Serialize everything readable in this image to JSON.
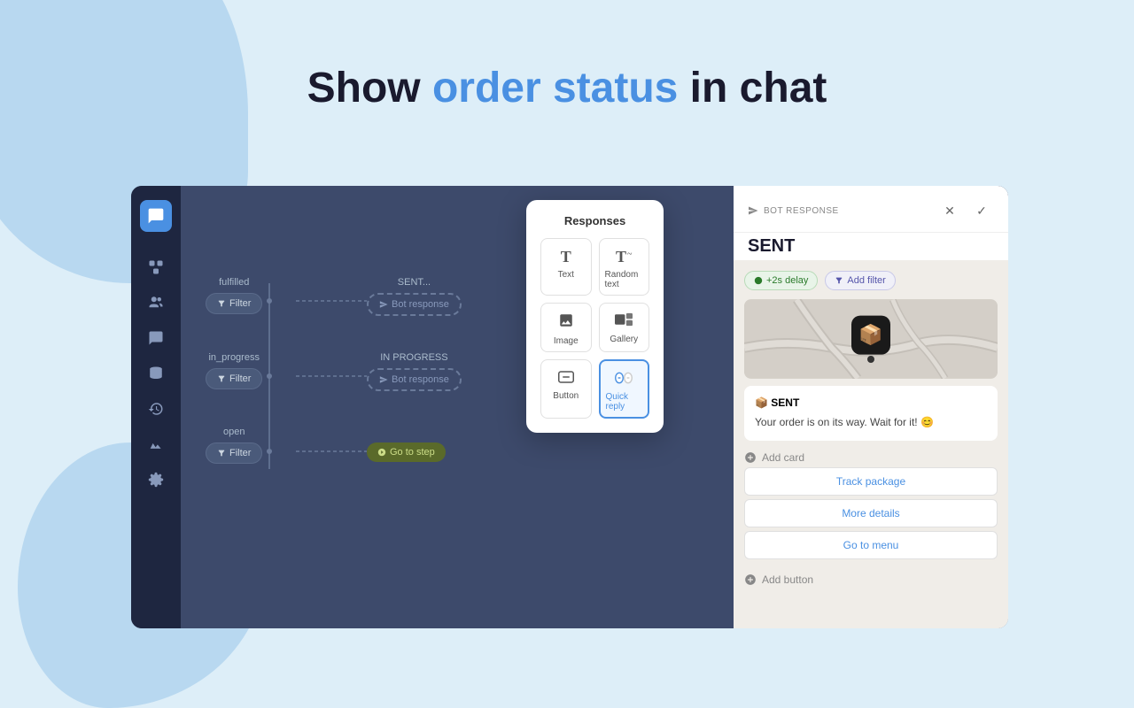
{
  "heading": {
    "prefix": "Show ",
    "highlight1": "order status",
    "middle": " in ",
    "rest": "chat"
  },
  "sidebar": {
    "logo_icon": "💬",
    "items": [
      {
        "icon": "⊞",
        "label": "flow-icon"
      },
      {
        "icon": "👥",
        "label": "contacts-icon"
      },
      {
        "icon": "💬",
        "label": "chat-icon"
      },
      {
        "icon": "🗄",
        "label": "data-icon"
      },
      {
        "icon": "🕐",
        "label": "history-icon"
      },
      {
        "icon": "📈",
        "label": "analytics-icon"
      },
      {
        "icon": "⚙",
        "label": "settings-icon"
      }
    ]
  },
  "flow": {
    "nodes": [
      {
        "label": "fulfilled",
        "filter_text": "Filter",
        "response_text": "Bot response",
        "response_label": "SENT..."
      },
      {
        "label": "in_progress",
        "filter_text": "Filter",
        "response_text": "Bot response",
        "response_label": "IN PROGRESS"
      },
      {
        "label": "open",
        "filter_text": "Filter",
        "step_text": "Go to step"
      }
    ]
  },
  "responses_panel": {
    "title": "Responses",
    "items": [
      {
        "icon": "T",
        "label": "Text",
        "highlighted": false
      },
      {
        "icon": "T̃",
        "label": "Random text",
        "highlighted": false
      },
      {
        "icon": "🖼",
        "label": "Image",
        "highlighted": false
      },
      {
        "icon": "⊞",
        "label": "Gallery",
        "highlighted": false
      },
      {
        "icon": "▭",
        "label": "Button",
        "highlighted": false
      },
      {
        "icon": "⟛",
        "label": "Quick reply",
        "highlighted": true
      }
    ]
  },
  "bot_panel": {
    "bot_label": "BOT RESPONSE",
    "title": "SENT",
    "delay_badge": "+2s delay",
    "filter_badge": "Add filter",
    "message_title": "📦 SENT",
    "message_text": "Your order is on its way. Wait for it! 😊",
    "action_buttons": [
      "Track package",
      "More details",
      "Go to menu"
    ],
    "add_card_label": "Add card",
    "add_button_label": "Add button"
  }
}
